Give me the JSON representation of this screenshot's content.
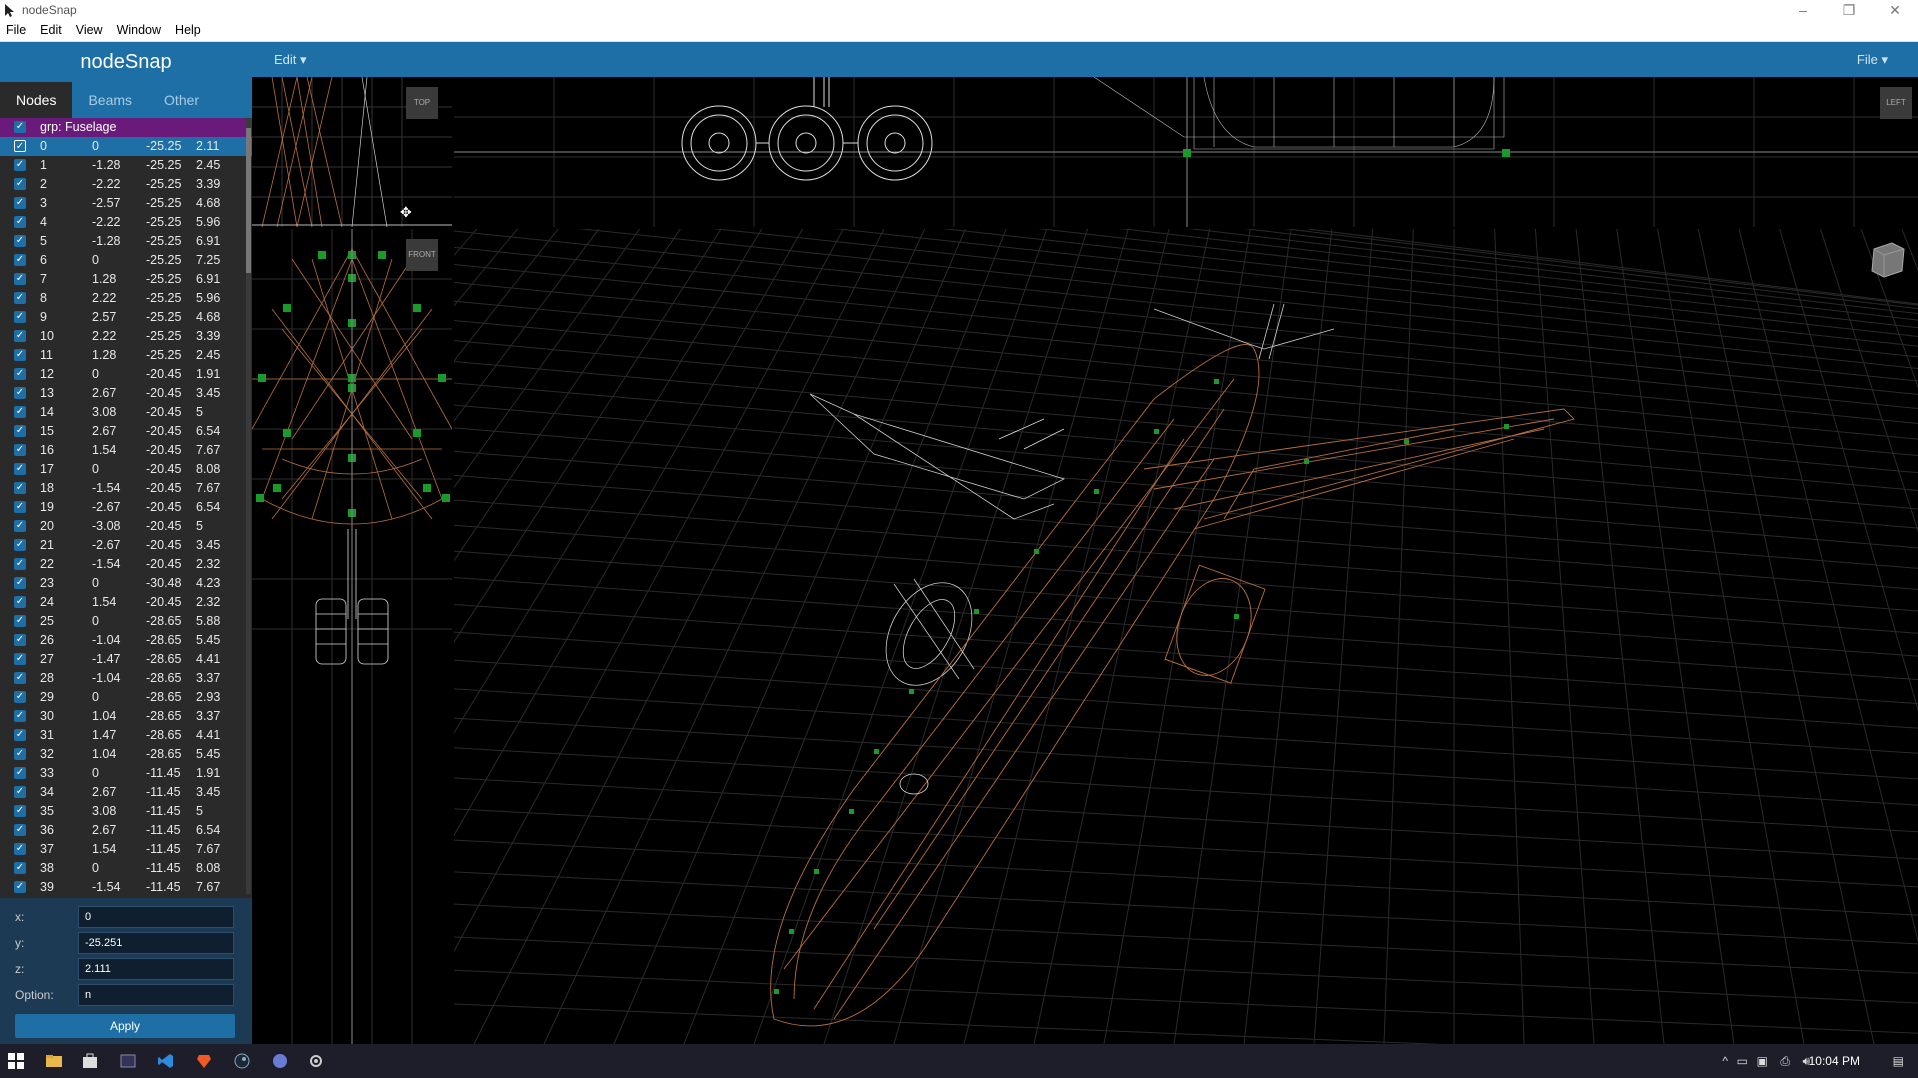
{
  "window": {
    "title": "nodeSnap"
  },
  "menu": [
    "File",
    "Edit",
    "View",
    "Window",
    "Help"
  ],
  "sidebar": {
    "brand": "nodeSnap",
    "tabs": [
      {
        "label": "Nodes",
        "active": true
      },
      {
        "label": "Beams",
        "active": false
      },
      {
        "label": "Other",
        "active": false
      }
    ],
    "group": "grp: Fuselage",
    "nodes": [
      [
        "0",
        "0",
        "-25.25",
        "2.11"
      ],
      [
        "1",
        "-1.28",
        "-25.25",
        "2.45"
      ],
      [
        "2",
        "-2.22",
        "-25.25",
        "3.39"
      ],
      [
        "3",
        "-2.57",
        "-25.25",
        "4.68"
      ],
      [
        "4",
        "-2.22",
        "-25.25",
        "5.96"
      ],
      [
        "5",
        "-1.28",
        "-25.25",
        "6.91"
      ],
      [
        "6",
        "0",
        "-25.25",
        "7.25"
      ],
      [
        "7",
        "1.28",
        "-25.25",
        "6.91"
      ],
      [
        "8",
        "2.22",
        "-25.25",
        "5.96"
      ],
      [
        "9",
        "2.57",
        "-25.25",
        "4.68"
      ],
      [
        "10",
        "2.22",
        "-25.25",
        "3.39"
      ],
      [
        "11",
        "1.28",
        "-25.25",
        "2.45"
      ],
      [
        "12",
        "0",
        "-20.45",
        "1.91"
      ],
      [
        "13",
        "2.67",
        "-20.45",
        "3.45"
      ],
      [
        "14",
        "3.08",
        "-20.45",
        "5"
      ],
      [
        "15",
        "2.67",
        "-20.45",
        "6.54"
      ],
      [
        "16",
        "1.54",
        "-20.45",
        "7.67"
      ],
      [
        "17",
        "0",
        "-20.45",
        "8.08"
      ],
      [
        "18",
        "-1.54",
        "-20.45",
        "7.67"
      ],
      [
        "19",
        "-2.67",
        "-20.45",
        "6.54"
      ],
      [
        "20",
        "-3.08",
        "-20.45",
        "5"
      ],
      [
        "21",
        "-2.67",
        "-20.45",
        "3.45"
      ],
      [
        "22",
        "-1.54",
        "-20.45",
        "2.32"
      ],
      [
        "23",
        "0",
        "-30.48",
        "4.23"
      ],
      [
        "24",
        "1.54",
        "-20.45",
        "2.32"
      ],
      [
        "25",
        "0",
        "-28.65",
        "5.88"
      ],
      [
        "26",
        "-1.04",
        "-28.65",
        "5.45"
      ],
      [
        "27",
        "-1.47",
        "-28.65",
        "4.41"
      ],
      [
        "28",
        "-1.04",
        "-28.65",
        "3.37"
      ],
      [
        "29",
        "0",
        "-28.65",
        "2.93"
      ],
      [
        "30",
        "1.04",
        "-28.65",
        "3.37"
      ],
      [
        "31",
        "1.47",
        "-28.65",
        "4.41"
      ],
      [
        "32",
        "1.04",
        "-28.65",
        "5.45"
      ],
      [
        "33",
        "0",
        "-11.45",
        "1.91"
      ],
      [
        "34",
        "2.67",
        "-11.45",
        "3.45"
      ],
      [
        "35",
        "3.08",
        "-11.45",
        "5"
      ],
      [
        "36",
        "2.67",
        "-11.45",
        "6.54"
      ],
      [
        "37",
        "1.54",
        "-11.45",
        "7.67"
      ],
      [
        "38",
        "0",
        "-11.45",
        "8.08"
      ],
      [
        "39",
        "-1.54",
        "-11.45",
        "7.67"
      ]
    ],
    "selected_index": 0
  },
  "editor": {
    "x_label": "x:",
    "x_value": "0",
    "y_label": "y:",
    "y_value": "-25.251",
    "z_label": "z:",
    "z_value": "2.111",
    "option_label": "Option:",
    "option_value": "n",
    "apply_label": "Apply"
  },
  "toolbar": {
    "edit_label": "Edit ▾",
    "file_label": "File ▾"
  },
  "viewports": {
    "top_label": "TOP",
    "front_label": "FRONT",
    "left_label": "LEFT"
  },
  "taskbar": {
    "clock": "10:04 PM"
  },
  "colors": {
    "accent": "#1d6fa5",
    "group": "#6a1a7a",
    "wire_orange": "#b8703f",
    "wire_white": "#cfcfcf",
    "node_green": "#1a9a2a"
  }
}
